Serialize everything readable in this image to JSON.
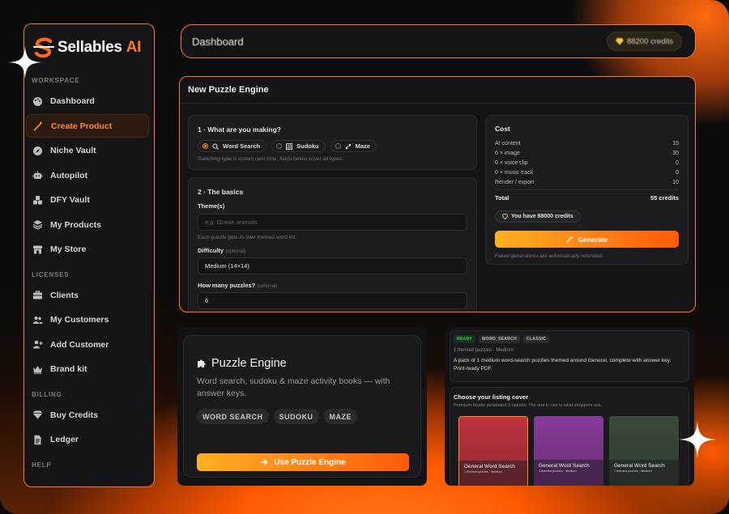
{
  "brand": {
    "name": "Sellables",
    "suffix": "AI"
  },
  "sidebar": {
    "workspace_label": "WORKSPACE",
    "workspace": [
      {
        "label": "Dashboard",
        "icon": "palette-icon"
      },
      {
        "label": "Create Product",
        "icon": "magic-wand-icon",
        "active": true
      },
      {
        "label": "Niche Vault",
        "icon": "compass-icon"
      },
      {
        "label": "Autopilot",
        "icon": "robot-icon"
      },
      {
        "label": "DFY Vault",
        "icon": "boxes-icon"
      },
      {
        "label": "My Products",
        "icon": "layers-icon"
      },
      {
        "label": "My Store",
        "icon": "store-icon"
      }
    ],
    "licenses_label": "LICENSES",
    "licenses": [
      {
        "label": "Clients",
        "icon": "briefcase-icon"
      },
      {
        "label": "My Customers",
        "icon": "users-icon"
      },
      {
        "label": "Add Customer",
        "icon": "user-plus-icon"
      },
      {
        "label": "Brand kit",
        "icon": "crown-icon"
      }
    ],
    "billing_label": "BILLING",
    "billing": [
      {
        "label": "Buy Credits",
        "icon": "diamond-icon"
      },
      {
        "label": "Ledger",
        "icon": "document-icon"
      }
    ],
    "help_label": "HELP"
  },
  "header": {
    "title": "Dashboard",
    "credits": "88200 credits"
  },
  "engine": {
    "title": "New Puzzle Engine",
    "step1": {
      "title": "1 · What are you making?",
      "options": [
        {
          "label": "Word Search",
          "selected": true
        },
        {
          "label": "Sudoku"
        },
        {
          "label": "Maze"
        }
      ],
      "hint": "Switching type is instant next time; fields below cover all types."
    },
    "step2": {
      "title": "2 · The basics",
      "themes_label": "Theme(s)",
      "themes_placeholder": "e.g. Ocean animals",
      "themes_hint": "Each puzzle gets its own themed word list.",
      "difficulty_label": "Difficulty",
      "difficulty_tag": "(optional)",
      "difficulty_value": "Medium (14×14)",
      "count_label": "How many puzzles?",
      "count_tag": "(optional)",
      "count_value": "6"
    },
    "cost": {
      "title": "Cost",
      "rows": [
        {
          "label": "AI content",
          "value": "15"
        },
        {
          "label": "6 × image",
          "value": "30"
        },
        {
          "label": "0 × voice clip",
          "value": "0"
        },
        {
          "label": "0 × music track",
          "value": "0"
        },
        {
          "label": "Render / export",
          "value": "10"
        }
      ],
      "total_label": "Total",
      "total_value": "55 credits",
      "have": "You have 88000 credits",
      "generate": "Generate",
      "refund_note": "Failed generations are automatically refunded."
    }
  },
  "promo": {
    "title": "Puzzle Engine",
    "description": "Word search, sudoku & maze activity books — with answer keys.",
    "tags": [
      "WORD SEARCH",
      "SUDOKU",
      "MAZE"
    ],
    "cta": "Use Puzzle Engine"
  },
  "result": {
    "badges": [
      "READY",
      "WORD_SEARCH",
      "CLASSIC"
    ],
    "subtitle": "1 themed puzzles · Medium",
    "description": "A pack of 1 medium word-search puzzles themed around General, complete with answer key. Print-ready PDF.",
    "cover_title": "Choose your listing cover",
    "cover_sub": "Premium Studio generated 3 options. The one in use is what shoppers see.",
    "covers": [
      {
        "name": "General Word Search",
        "meta": "1 themed puzzles · Medium",
        "color": "#c0323e"
      },
      {
        "name": "General Word Search",
        "meta": "1 themed puzzles · Medium",
        "color": "#8a3a9a"
      },
      {
        "name": "General Word Search",
        "meta": "1 themed puzzles · Medium",
        "color": "#3a4a3a"
      }
    ]
  },
  "colors": {
    "accent": "#ff7a1a",
    "panel": "#141416"
  }
}
